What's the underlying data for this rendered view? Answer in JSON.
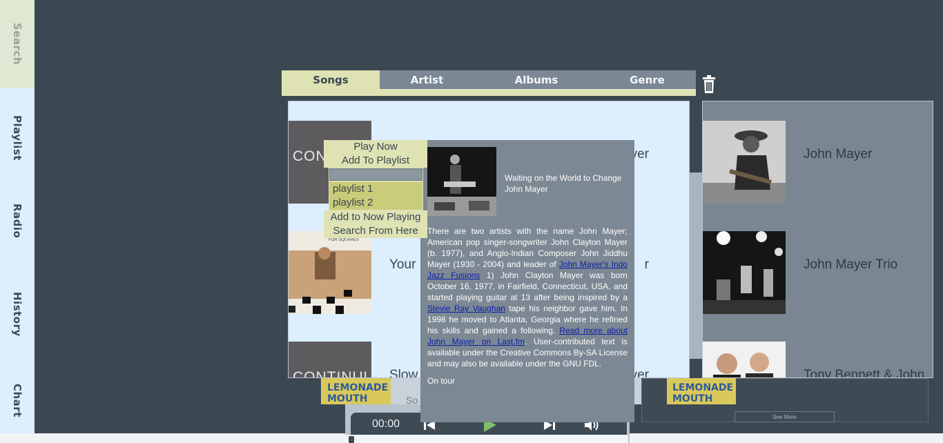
{
  "sidebar": {
    "items": [
      {
        "label": "Search"
      },
      {
        "label": "Playlist"
      },
      {
        "label": "Radio"
      },
      {
        "label": "History"
      },
      {
        "label": "Chart"
      }
    ]
  },
  "tabs": [
    {
      "label": "Songs",
      "active": true
    },
    {
      "label": "Artist",
      "active": false
    },
    {
      "label": "Albums",
      "active": false
    },
    {
      "label": "Genre",
      "active": false
    }
  ],
  "songs": [
    {
      "title_visible": "",
      "artist_visible": "Mayer",
      "art": "CONTINUUM"
    },
    {
      "title_visible": "Your",
      "artist_visible": "r",
      "art": "JOHN MAYER ROOM FOR SQUARES"
    },
    {
      "title_visible": "Slow",
      "artist_visible": "Mayer",
      "art": "CONTINUUM"
    }
  ],
  "artists": [
    {
      "name": "John Mayer"
    },
    {
      "name": "John Mayer Trio"
    },
    {
      "name": "Tony Bennett & John"
    }
  ],
  "context_menu": {
    "play_now": "Play Now",
    "add_to_playlist": "Add To Playlist",
    "playlists": [
      "playlist 1",
      "playlist 2"
    ],
    "add_to_now_playing": "Add to Now Playing",
    "search_from_here": "Search From Here"
  },
  "info_popup": {
    "song_title": "Waiting on the World to Change",
    "song_artist": "John Mayer",
    "bio_part1": "There are two artists with the name John Mayer; American pop singer-songwriter John Clayton Mayer (b. 1977), and Anglo-Indian Composer John Jiddhu Mayer (1930 - 2004) and leader of ",
    "bio_link1": "John Mayer's Indo Jazz Fusions",
    "bio_part2": " 1) John Clayton Mayer was born October 16, 1977, in Fairfield, Connecticut, USA, and started playing guitar at 13 after being inspired by a ",
    "bio_link2": "Stevie Ray Vaughan",
    "bio_part3": " tape his neighbor gave him. In 1998 he moved to Atlanta, Georgia where he refined his skills and gained a following. ",
    "bio_link3": "Read more about John Mayer on Last.fm",
    "bio_part4": ". User-contributed text is available under the Creative Commons By-SA License and may also be available under the GNU FDL.",
    "tour_status": "On tour"
  },
  "strip": {
    "lemonade_label": "LEMONADE MOUTH",
    "partial_text": "So",
    "see_more": "See More"
  },
  "player": {
    "time": "00:00",
    "progress": 0.0
  },
  "colors": {
    "background": "#3b4852",
    "accent": "#dfe3b4",
    "panel": "#ddeeff",
    "muted_panel": "#7a8792"
  }
}
